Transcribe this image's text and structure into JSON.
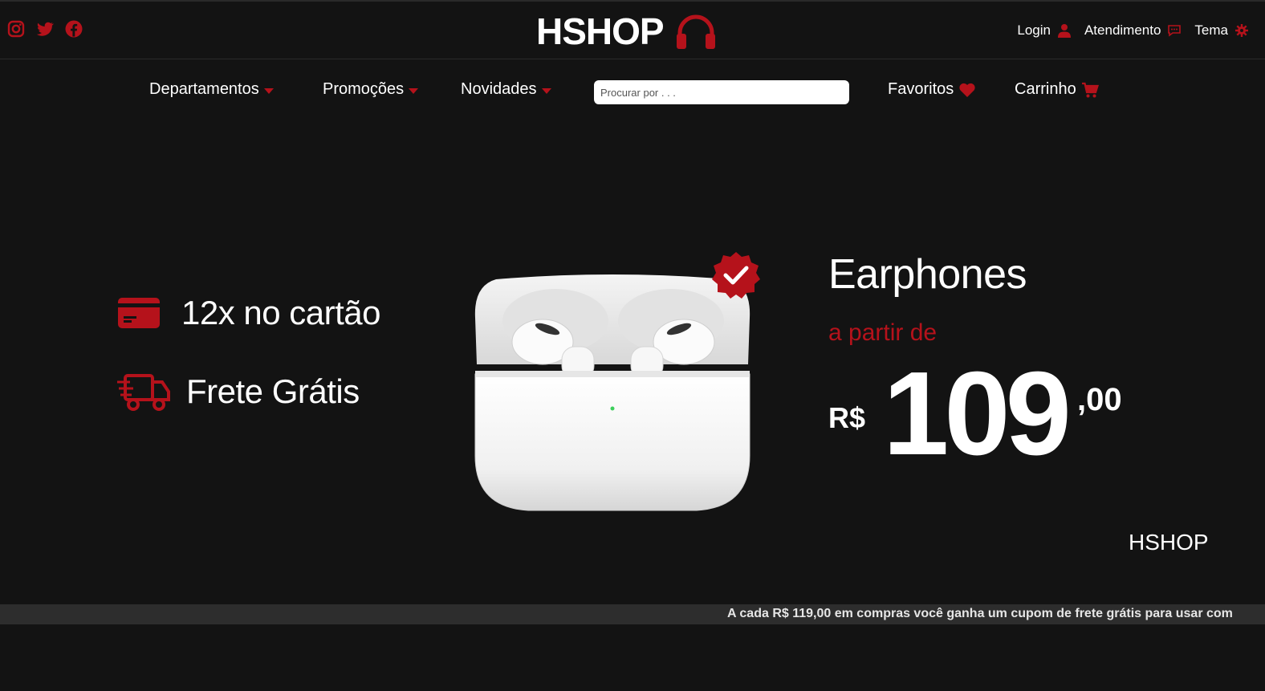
{
  "colors": {
    "background": "#131313",
    "accent": "#b5121b",
    "text": "#ffffff",
    "ticker_bg": "#2d2d2d"
  },
  "social": {
    "icons": [
      "instagram-icon",
      "twitter-icon",
      "facebook-icon"
    ]
  },
  "header": {
    "logo_text": "HSHOP",
    "logo_icon": "headphones-icon",
    "links": [
      {
        "label": "Login",
        "icon": "user-icon"
      },
      {
        "label": "Atendimento",
        "icon": "chat-icon"
      },
      {
        "label": "Tema",
        "icon": "gear-icon"
      }
    ]
  },
  "nav": {
    "items": [
      {
        "label": "Departamentos"
      },
      {
        "label": "Promoções"
      },
      {
        "label": "Novidades"
      }
    ],
    "search_placeholder": "Procurar por . . .",
    "favorites_label": "Favoritos",
    "cart_label": "Carrinho"
  },
  "hero": {
    "features": [
      {
        "text": "12x no cartão",
        "icon": "credit-card-icon"
      },
      {
        "text": "Frete Grátis",
        "icon": "truck-icon"
      }
    ],
    "product_title": "Earphones",
    "subtitle": "a partir de",
    "currency": "R$",
    "price": "109",
    "cents": ",00",
    "brand": "HSHOP"
  },
  "ticker": {
    "text": "A cada R$ 119,00 em compras você ganha um cupom de frete grátis para usar com"
  }
}
